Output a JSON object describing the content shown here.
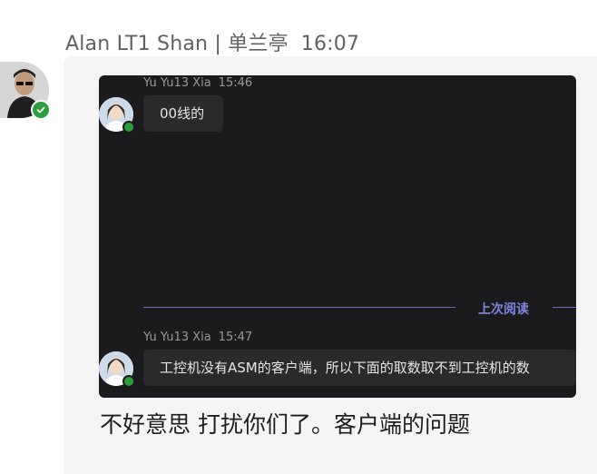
{
  "message": {
    "sender": "Alan LT1 Shan | 单兰亭",
    "time": "16:07",
    "text": "不好意思 打扰你们了。客户端的问题"
  },
  "screenshot": {
    "messages": [
      {
        "sender": "Yu Yu13 Xia",
        "time": "15:46",
        "text": "00线的"
      },
      {
        "sender": "Yu Yu13 Xia",
        "time": "15:47",
        "text": "工控机没有ASM的客户端，所以下面的取数取不到工控机的数"
      }
    ],
    "divider_label": "上次阅读"
  },
  "colors": {
    "presence": "#2e9e3c",
    "divider": "#6f6fb8",
    "divider_label": "#7f86e0"
  }
}
